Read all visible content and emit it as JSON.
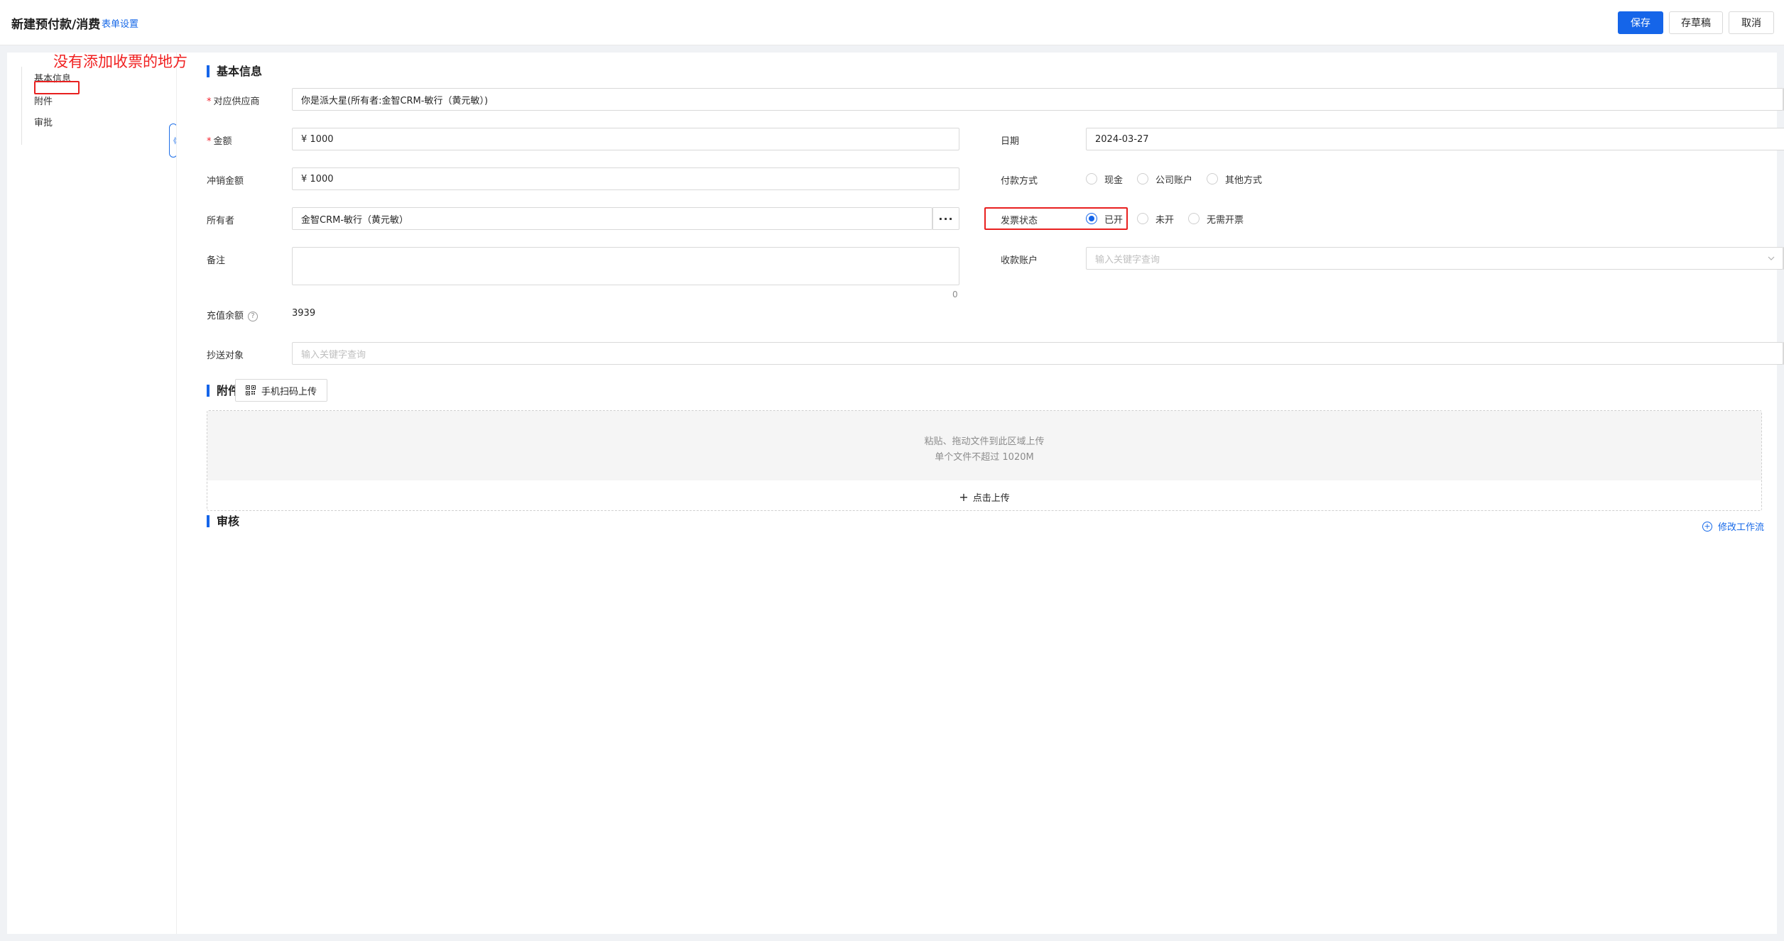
{
  "header": {
    "title": "新建预付款/消费",
    "form_settings": "表单设置",
    "save": "保存",
    "draft": "存草稿",
    "cancel": "取消"
  },
  "annotation": {
    "text": "没有添加收票的地方"
  },
  "sidebar": {
    "items": [
      {
        "label": "基本信息"
      },
      {
        "label": "附件"
      },
      {
        "label": "审批"
      }
    ],
    "collapse_glyph": "《"
  },
  "sections": {
    "basic": "基本信息",
    "attachments": "附件",
    "review": "审核"
  },
  "form": {
    "supplier": {
      "label": "对应供应商",
      "value": "你是派大星(所有者:金智CRM-敏行（黄元敏）)"
    },
    "amount": {
      "label": "金额",
      "value": "¥  1000"
    },
    "date": {
      "label": "日期",
      "value": "2024-03-27"
    },
    "offset_amount": {
      "label": "冲销金额",
      "value": "¥  1000"
    },
    "payment_method": {
      "label": "付款方式",
      "options": [
        "现金",
        "公司账户",
        "其他方式"
      ]
    },
    "owner": {
      "label": "所有者",
      "value": "金智CRM-敏行（黄元敏）"
    },
    "invoice_status": {
      "label": "发票状态",
      "options": [
        "已开",
        "未开",
        "无需开票"
      ],
      "selected": "已开"
    },
    "remark": {
      "label": "备注",
      "counter": "0"
    },
    "receive_account": {
      "label": "收款账户",
      "placeholder": "输入关键字查询"
    },
    "balance": {
      "label": "充值余额",
      "value": "3939"
    },
    "cc": {
      "label": "抄送对象",
      "placeholder": "输入关键字查询"
    }
  },
  "attachments": {
    "scan_upload": "手机扫码上传",
    "drop_hint": "粘贴、拖动文件到此区域上传",
    "size_hint": "单个文件不超过 1020M",
    "click_upload": "点击上传"
  },
  "review": {
    "edit_workflow": "修改工作流"
  },
  "icons": {
    "more": "ellipsis-icon",
    "calendar": "calendar-icon",
    "chevron": "chevron-down-icon",
    "help": "help-icon",
    "qr": "qr-code-icon",
    "plus": "plus-icon"
  },
  "colors": {
    "primary": "#1565e9",
    "annotation": "#e8201f",
    "required": "#f5222d"
  }
}
